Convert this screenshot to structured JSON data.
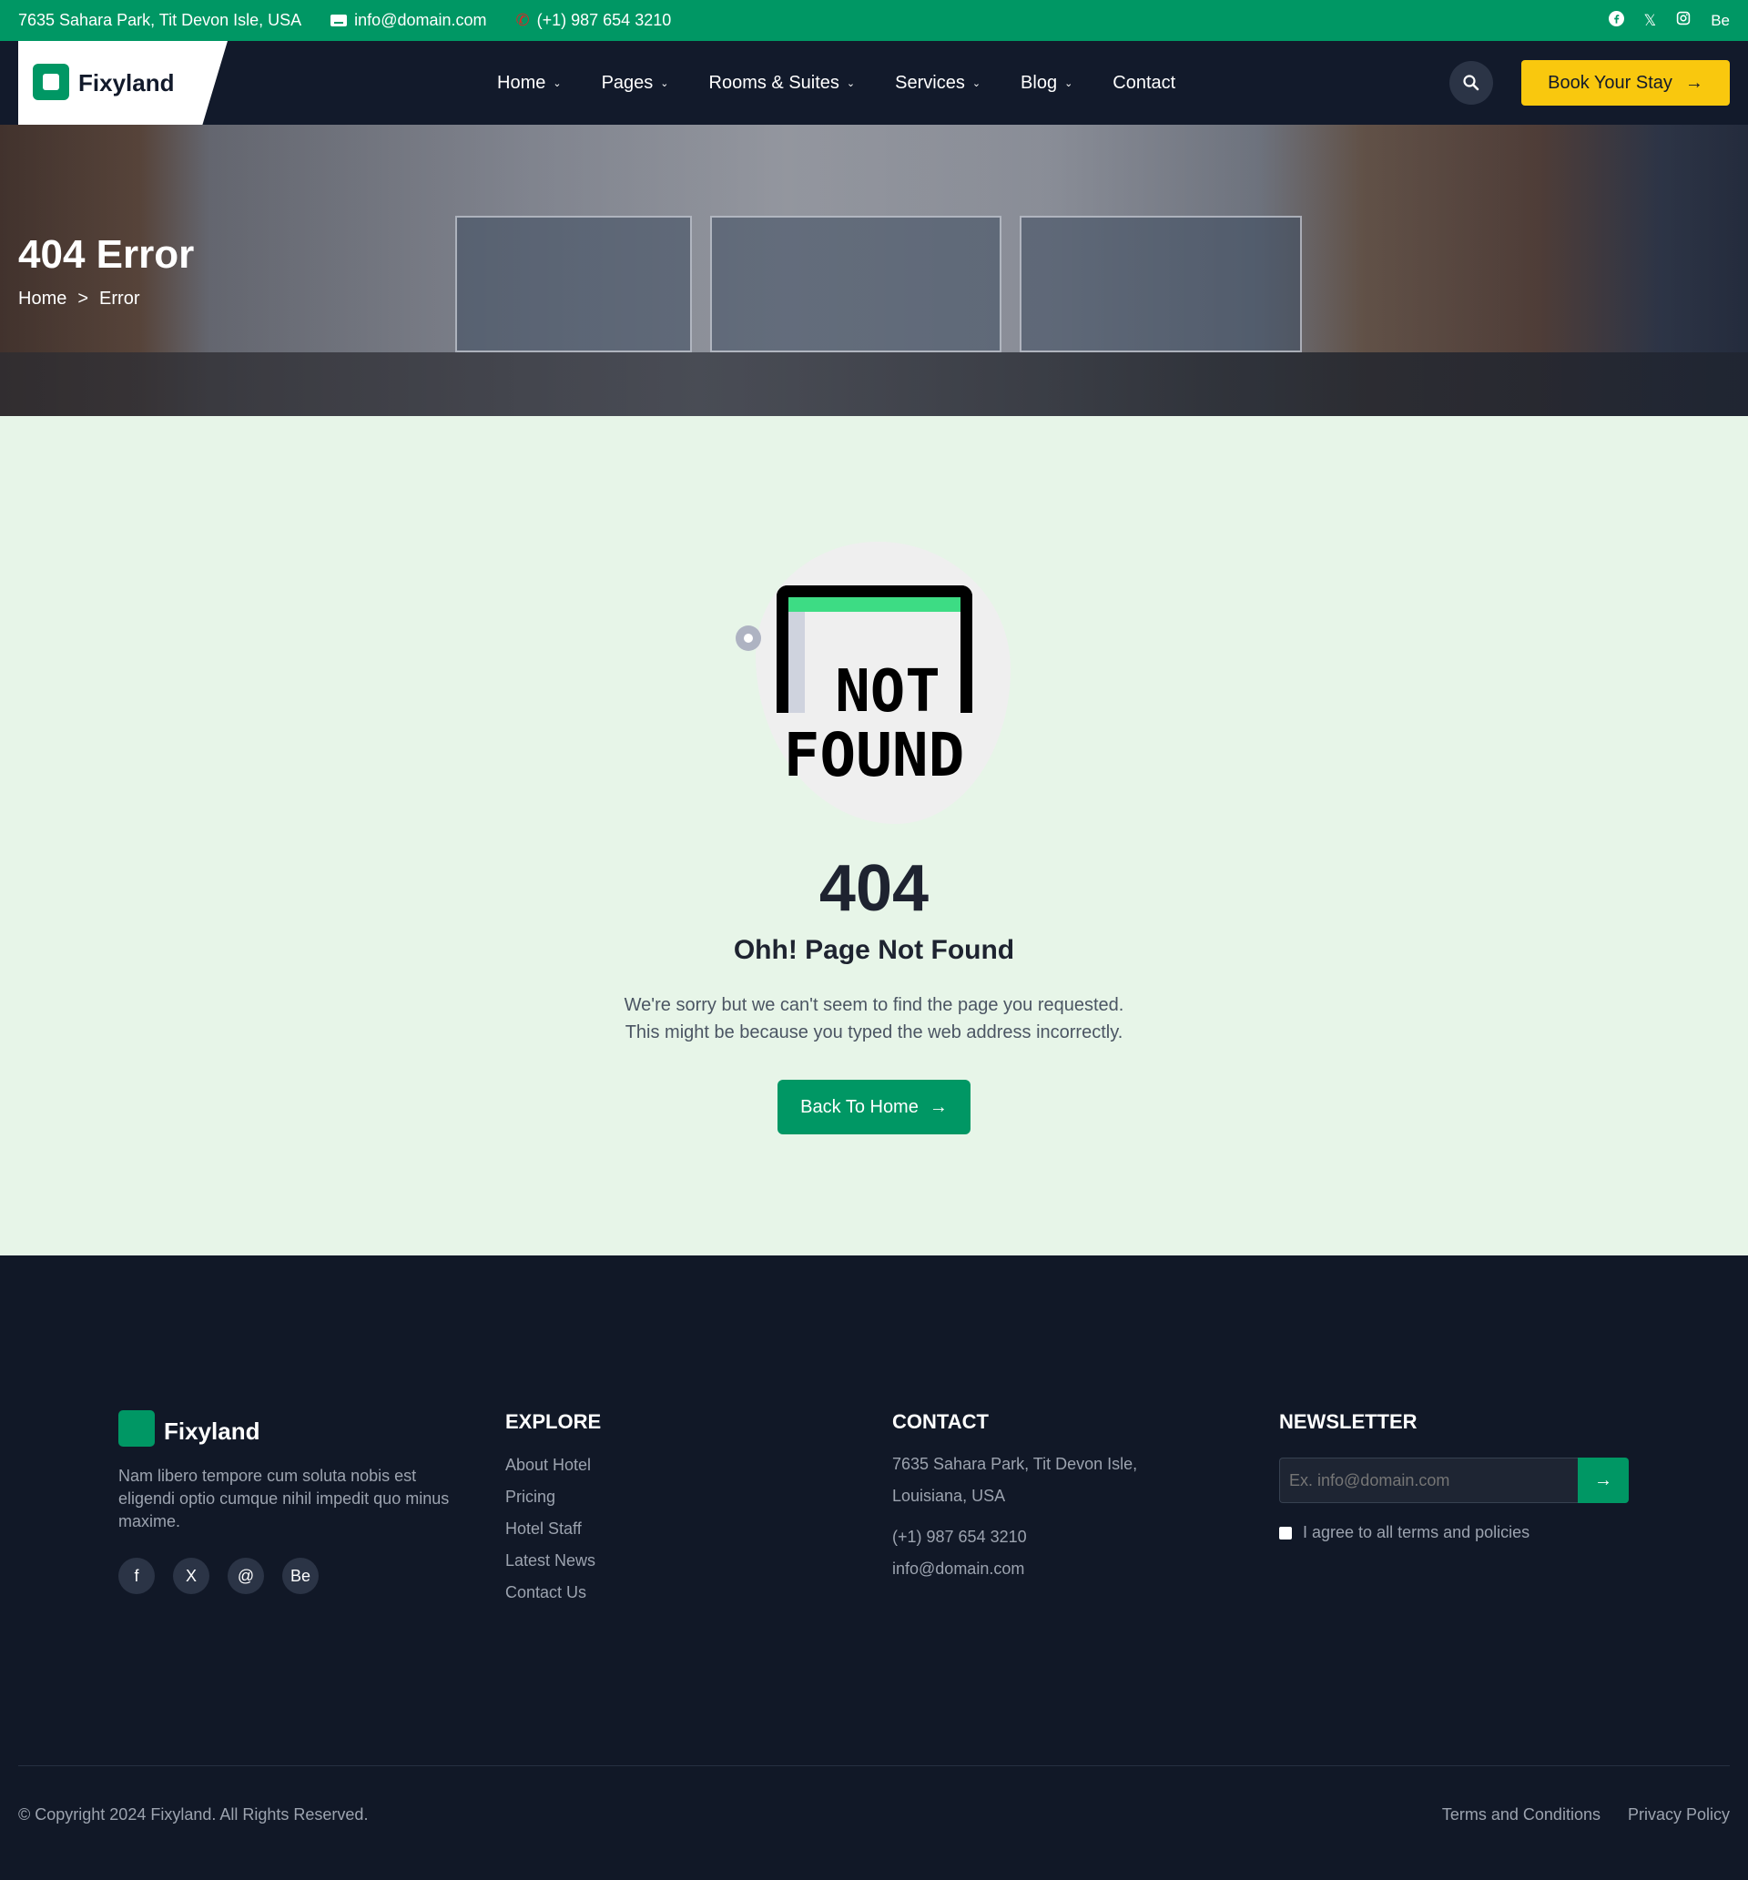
{
  "topbar": {
    "address": "7635 Sahara Park, Tit Devon Isle, USA",
    "email": "info@domain.com",
    "phone": "(+1) 987 654 3210",
    "social": [
      "facebook-icon",
      "x-icon",
      "instagram-icon",
      "behance-icon"
    ],
    "social_labels": {
      "x": "𝕏",
      "behance": "Be"
    }
  },
  "header": {
    "brand": "Fixyland",
    "nav": [
      {
        "label": "Home",
        "dropdown": true
      },
      {
        "label": "Pages",
        "dropdown": true
      },
      {
        "label": "Rooms & Suites",
        "dropdown": true
      },
      {
        "label": "Services",
        "dropdown": true
      },
      {
        "label": "Blog",
        "dropdown": true
      },
      {
        "label": "Contact",
        "dropdown": false
      }
    ],
    "book_label": "Book Your Stay",
    "arrow": "→"
  },
  "hero": {
    "title": "404 Error",
    "breadcrumb": [
      "Home",
      ">",
      "Error"
    ]
  },
  "error": {
    "illustration_line1": "NOT",
    "illustration_line2": "FOUND",
    "code": "404",
    "title": "Ohh! Page Not Found",
    "desc_line1": "We're sorry but we can't seem to find the page you requested.",
    "desc_line2": "This might be because you typed the web address incorrectly.",
    "button": "Back To Home",
    "arrow": "→"
  },
  "footer": {
    "brand": "Fixyland",
    "about": "Nam libero tempore cum soluta nobis est eligendi optio cumque nihil impedit quo minus maxime.",
    "socials": [
      "f",
      "X",
      "@",
      "Be"
    ],
    "explore_title": "EXPLORE",
    "explore": [
      "About Hotel",
      "Pricing",
      "Hotel Staff",
      "Latest News",
      "Contact Us"
    ],
    "contact_title": "CONTACT",
    "contact_address_1": "7635 Sahara Park, Tit Devon Isle,",
    "contact_address_2": "Louisiana, USA",
    "contact_phone": "(+1) 987 654 3210",
    "contact_email": "info@domain.com",
    "newsletter_title": "NEWSLETTER",
    "newsletter_placeholder": "Ex. info@domain.com",
    "newsletter_arrow": "→",
    "agree": "I agree to all terms and policies",
    "copyright": "© Copyright 2024 Fixyland. All Rights Reserved.",
    "terms": "Terms and Conditions",
    "privacy": "Privacy Policy"
  },
  "colors": {
    "green": "#009764",
    "navy": "#121a2b",
    "yellow": "#f9c80e",
    "mint": "#e7f5e8"
  }
}
